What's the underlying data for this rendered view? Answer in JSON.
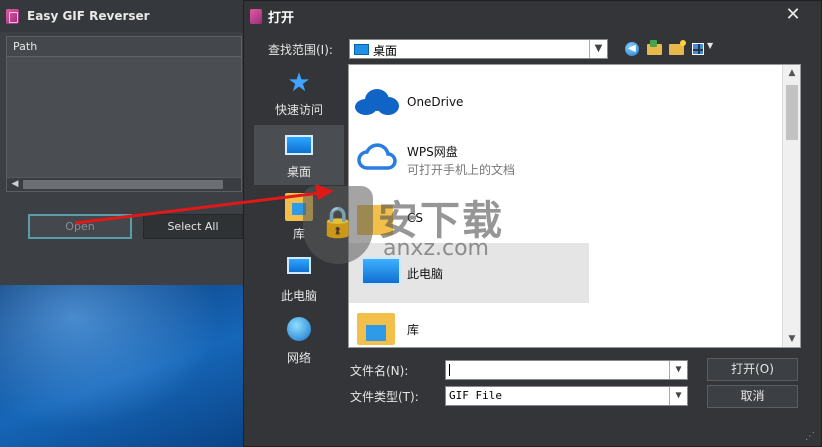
{
  "app_window": {
    "title": "Easy GIF Reverser",
    "path_header": "Path",
    "open_button": "Open",
    "select_all_button": "Select All"
  },
  "dialog": {
    "title": "打开",
    "look_in_label": "查找范围(I):",
    "look_in_value": "桌面",
    "places": [
      {
        "label": "快速访问",
        "icon": "star-icon"
      },
      {
        "label": "桌面",
        "icon": "desktop-icon",
        "selected": true
      },
      {
        "label": "库",
        "icon": "library-icon"
      },
      {
        "label": "此电脑",
        "icon": "computer-icon"
      },
      {
        "label": "网络",
        "icon": "network-icon"
      }
    ],
    "items": [
      {
        "name": "OneDrive",
        "sub": "",
        "icon": "onedrive-cloud-icon"
      },
      {
        "name": "WPS网盘",
        "sub": "可打开手机上的文档",
        "icon": "wps-cloud-icon"
      },
      {
        "name": "CS",
        "sub": "",
        "icon": "user-folder-icon"
      },
      {
        "name": "此电脑",
        "sub": "",
        "icon": "computer-icon",
        "selected": true
      },
      {
        "name": "库",
        "sub": "",
        "icon": "library-icon"
      }
    ],
    "filename_label": "文件名(N):",
    "filename_value": "",
    "filetype_label": "文件类型(T):",
    "filetype_value": "GIF File",
    "open_button": "打开(O)",
    "cancel_button": "取消"
  },
  "watermark": {
    "text": "安下载",
    "domain": "anxz.com"
  },
  "colors": {
    "arrow": "#e01818",
    "focus_border": "#5a9da8",
    "dialog_bg": "#333538",
    "accent_blue": "#1e90e6"
  }
}
